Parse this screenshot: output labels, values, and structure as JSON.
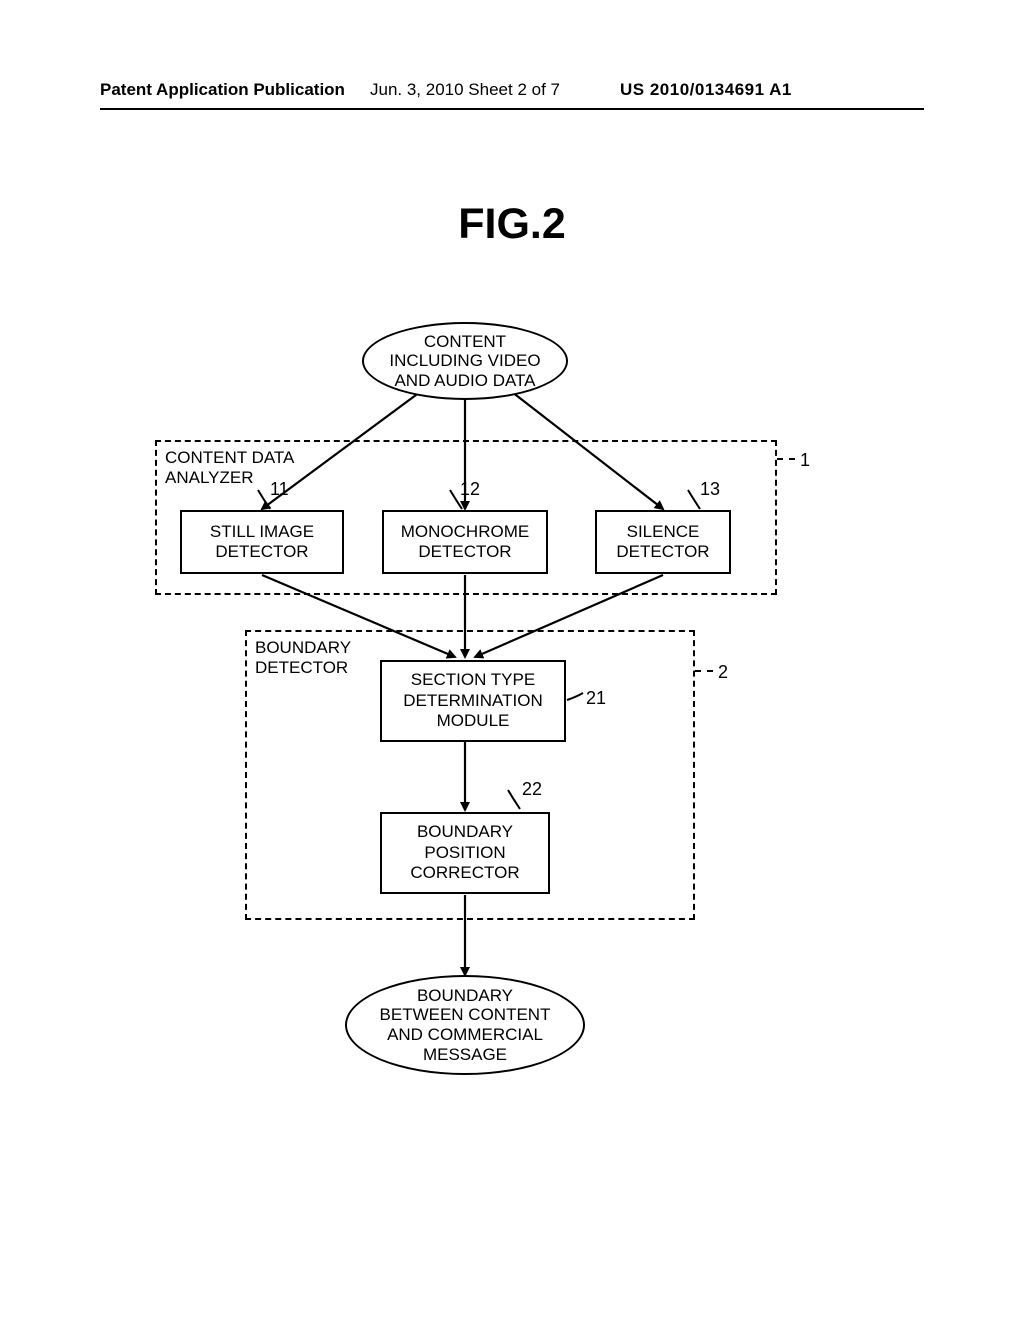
{
  "header": {
    "left": "Patent Application Publication",
    "center": "Jun. 3, 2010  Sheet 2 of 7",
    "right": "US 2010/0134691 A1"
  },
  "figure_title": "FIG.2",
  "nodes": {
    "content_in": "CONTENT\nINCLUDING VIDEO\nAND AUDIO DATA",
    "still_image_detector": "STILL IMAGE\nDETECTOR",
    "monochrome_detector": "MONOCHROME\nDETECTOR",
    "silence_detector": "SILENCE\nDETECTOR",
    "section_type_module": "SECTION TYPE\nDETERMINATION\nMODULE",
    "boundary_corrector": "BOUNDARY\nPOSITION\nCORRECTOR",
    "boundary_out": "BOUNDARY\nBETWEEN CONTENT\nAND COMMERCIAL\nMESSAGE"
  },
  "groups": {
    "content_data_analyzer": "CONTENT DATA\nANALYZER",
    "boundary_detector": "BOUNDARY\nDETECTOR"
  },
  "refs": {
    "r1": "1",
    "r2": "2",
    "r11": "11",
    "r12": "12",
    "r13": "13",
    "r21": "21",
    "r22": "22"
  }
}
